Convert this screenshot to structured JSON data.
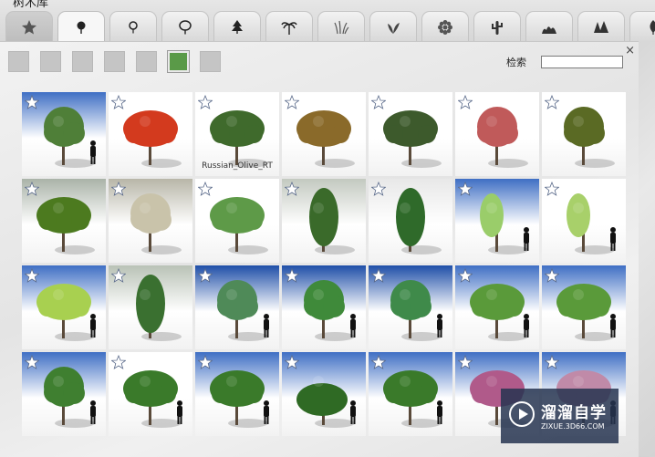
{
  "window": {
    "title_fragment": "树木库"
  },
  "tabs": [
    {
      "name": "tab-favorites",
      "icon": "star-icon"
    },
    {
      "name": "tab-round-tree",
      "icon": "round-tree-icon"
    },
    {
      "name": "tab-small-tree",
      "icon": "small-tree-icon"
    },
    {
      "name": "tab-broad-tree",
      "icon": "broad-tree-icon"
    },
    {
      "name": "tab-conifer",
      "icon": "conifer-icon"
    },
    {
      "name": "tab-palm",
      "icon": "palm-icon"
    },
    {
      "name": "tab-grass",
      "icon": "grass-icon"
    },
    {
      "name": "tab-plant",
      "icon": "leaf-plant-icon"
    },
    {
      "name": "tab-flower",
      "icon": "flower-icon"
    },
    {
      "name": "tab-cactus",
      "icon": "cactus-icon"
    },
    {
      "name": "tab-bushes",
      "icon": "bush-group-icon"
    },
    {
      "name": "tab-forest",
      "icon": "forest-icon"
    },
    {
      "name": "tab-leaf",
      "icon": "single-leaf-icon"
    }
  ],
  "swatches": [
    {
      "color": "#c5c5c5"
    },
    {
      "color": "#c5c5c5"
    },
    {
      "color": "#c5c5c5"
    },
    {
      "color": "#c5c5c5"
    },
    {
      "color": "#c5c5c5"
    },
    {
      "color": "#5a9a48",
      "selected": true
    },
    {
      "color": "#c5c5c5"
    }
  ],
  "search": {
    "label": "检索",
    "value": "",
    "placeholder": ""
  },
  "close_glyph": "×",
  "items": [
    {
      "sky": "#3f6fc4",
      "foliage": "#4f7f38",
      "shape": "round",
      "person": true
    },
    {
      "sky": "#ffffff",
      "foliage": "#d33a1e",
      "shape": "wide",
      "person": false
    },
    {
      "sky": "#ffffff",
      "foliage": "#3f6a2c",
      "shape": "wide",
      "person": false,
      "caption": "Russian_Olive_RT"
    },
    {
      "sky": "#ffffff",
      "foliage": "#8a6a2a",
      "shape": "wide",
      "person": false
    },
    {
      "sky": "#ffffff",
      "foliage": "#3d5a2c",
      "shape": "wide",
      "person": false
    },
    {
      "sky": "#ffffff",
      "foliage": "#c05a5a",
      "shape": "round",
      "person": false
    },
    {
      "sky": "#ffffff",
      "foliage": "#5a6a24",
      "shape": "round",
      "person": false
    },
    {
      "sky": "#aab3a8",
      "foliage": "#4c7a1f",
      "shape": "wide",
      "person": false
    },
    {
      "sky": "#b8b6a8",
      "foliage": "#c9c3aa",
      "shape": "round",
      "person": false
    },
    {
      "sky": "#ffffff",
      "foliage": "#5e9a48",
      "shape": "wide",
      "person": false
    },
    {
      "sky": "#c3c9c0",
      "foliage": "#3a6a2a",
      "shape": "tall",
      "person": false
    },
    {
      "sky": "#e8e8e8",
      "foliage": "#2f6a2a",
      "shape": "tall",
      "person": false
    },
    {
      "sky": "#3f6fc4",
      "foliage": "#9acd6a",
      "shape": "thin",
      "person": true
    },
    {
      "sky": "#ffffff",
      "foliage": "#a8d06a",
      "shape": "thin",
      "person": true
    },
    {
      "sky": "#3f6fc4",
      "foliage": "#a8d050",
      "shape": "wide",
      "person": true
    },
    {
      "sky": "#b9c2b6",
      "foliage": "#3a7030",
      "shape": "tall",
      "person": false
    },
    {
      "sky": "#1f4fa8",
      "foliage": "#4f8a58",
      "shape": "round",
      "person": true
    },
    {
      "sky": "#1f4fa8",
      "foliage": "#3f8a3a",
      "shape": "round",
      "person": true
    },
    {
      "sky": "#1f4fa8",
      "foliage": "#3f8a4a",
      "shape": "round",
      "person": true
    },
    {
      "sky": "#3f6fc4",
      "foliage": "#5a9a3a",
      "shape": "wide",
      "person": true
    },
    {
      "sky": "#3f6fc4",
      "foliage": "#5a9a3a",
      "shape": "wide",
      "person": true
    },
    {
      "sky": "#3f6fc4",
      "foliage": "#3f7f30",
      "shape": "round",
      "person": true
    },
    {
      "sky": "#ffffff",
      "foliage": "#3a7a2a",
      "shape": "wide",
      "person": true
    },
    {
      "sky": "#3f6fc4",
      "foliage": "#3a7a2a",
      "shape": "wide",
      "person": true
    },
    {
      "sky": "#3f6fc4",
      "foliage": "#2f6a24",
      "shape": "bush",
      "person": true
    },
    {
      "sky": "#3f6fc4",
      "foliage": "#3a7a2a",
      "shape": "wide",
      "person": true
    },
    {
      "sky": "#3f6fc4",
      "foliage": "#b05a8a",
      "shape": "wide",
      "person": false
    },
    {
      "sky": "#3f6fc4",
      "foliage": "#c08aa8",
      "shape": "wide",
      "person": true
    }
  ],
  "watermark": {
    "cn": "溜溜自学",
    "url": "ZIXUE.3D66.COM"
  }
}
